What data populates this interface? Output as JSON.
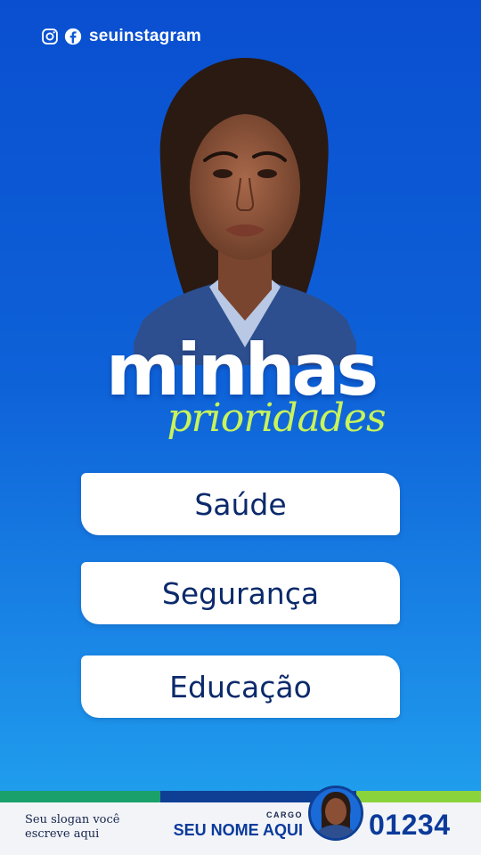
{
  "header": {
    "instagram_icon": "instagram-icon",
    "facebook_icon": "facebook-icon",
    "handle": "seuinstagram"
  },
  "title": {
    "main": "minhas",
    "sub": "prioridades"
  },
  "priorities": [
    {
      "label": "Saúde"
    },
    {
      "label": "Segurança"
    },
    {
      "label": "Educação"
    }
  ],
  "footer": {
    "slogan": "Seu slogan você escreve aqui",
    "cargo": "CARGO",
    "nome": "SEU NOME AQUI",
    "numero": "01234"
  },
  "colors": {
    "background_top": "#0a4fd0",
    "background_bottom": "#22a6ef",
    "accent_green": "#c8f35b",
    "card_text": "#0b2a6b",
    "footer_blue": "#0b3a9b"
  }
}
